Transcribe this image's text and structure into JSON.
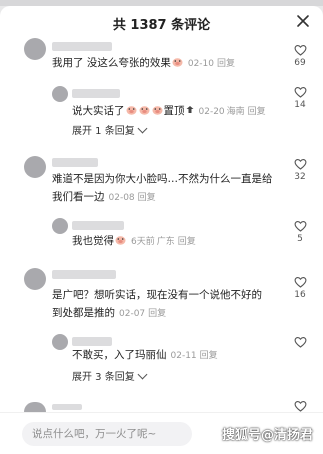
{
  "header": {
    "title": "共 1387 条评论",
    "close_icon": "close-icon"
  },
  "comments": [
    {
      "text": "我用了 没这么夸张的效果",
      "emoji": [
        "pig-face-emoji"
      ],
      "date": "02-10",
      "reply": "回复",
      "likes": "69"
    },
    {
      "text": "说大实话了",
      "emoji": [
        "pig-face-emoji",
        "pig-face-emoji",
        "pig-face-emoji"
      ],
      "suffix": "置顶",
      "badge": "top-badge-icon",
      "date": "02-20",
      "location": "海南",
      "reply": "回复",
      "likes": "14",
      "expand": "展开 1 条回复"
    },
    {
      "text_line1": "难道不是因为你大小脸吗…不然为什么一直是给",
      "text_line2": "我们看一边",
      "date": "02-08",
      "reply": "回复",
      "likes": "32"
    },
    {
      "text": "我也觉得",
      "emoji": [
        "pig-face-emoji"
      ],
      "date": "6天前",
      "location": "广东",
      "reply": "回复",
      "likes": "5"
    },
    {
      "text_line1": "是广吧？想听实话，现在没有一个说他不好的",
      "text_line2": "到处都是推的",
      "date": "02-07",
      "reply": "回复",
      "likes": "16"
    },
    {
      "text": "不敢买，入了玛丽仙",
      "date": "02-11",
      "reply": "回复",
      "likes": "",
      "expand": "展开 3 条回复"
    },
    {
      "likes": "",
      "partial": true
    }
  ],
  "input": {
    "placeholder": "说点什么吧，万一火了呢~"
  },
  "watermark": "搜狐号@清扬君",
  "colors": {
    "background": "#ffffff",
    "meta_gray": "#9a9a9a",
    "input_bg": "#f2f2f4"
  }
}
